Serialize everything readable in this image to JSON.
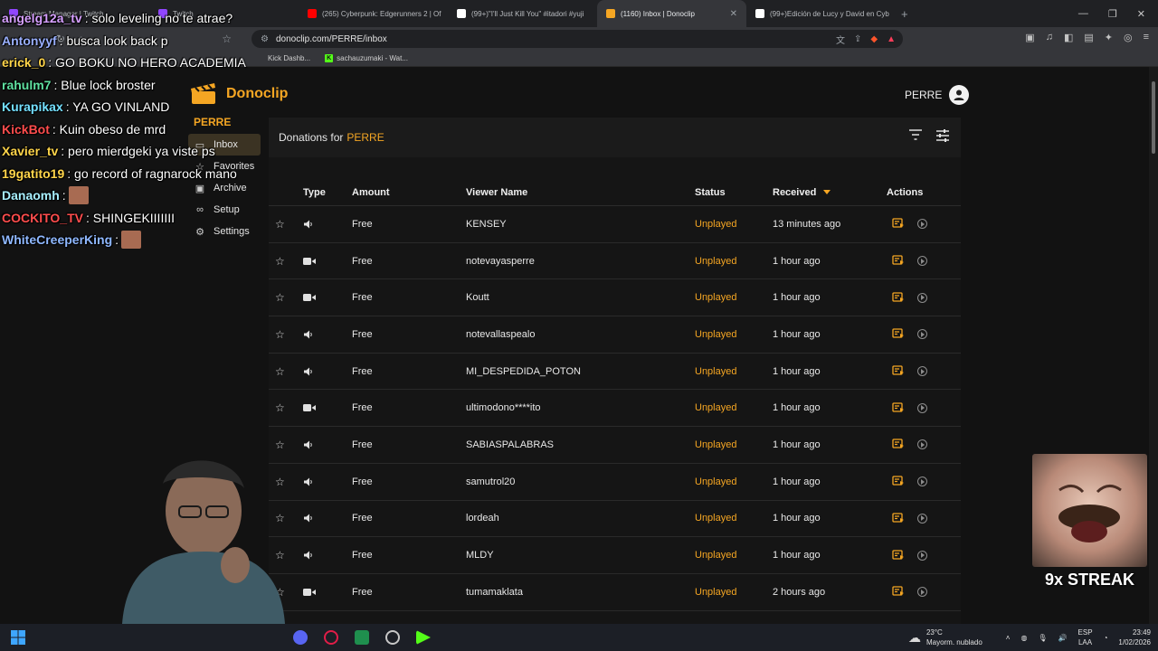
{
  "browser": {
    "tabs": [
      {
        "label": "Stream Manager | Twitch",
        "color": "#9146ff",
        "active": false
      },
      {
        "label": "Twitch",
        "color": "#9146ff",
        "active": false
      },
      {
        "label": "(265) Cyberpunk: Edgerunners 2 | Of",
        "color": "#ff0000",
        "active": false
      },
      {
        "label": "(99+)\"I'll Just Kill You\" #itadori #yuji",
        "color": "#ffffff",
        "active": false
      },
      {
        "label": "(1160) Inbox | Donoclip",
        "color": "#f5a623",
        "active": true
      },
      {
        "label": "(99+)Edición de Lucy y David en Cyb",
        "color": "#ffffff",
        "active": false
      }
    ],
    "url": "donoclip.com/PERRE/inbox",
    "bookmarks": [
      "Kick Dashb...",
      "sachauzumaki - Wat..."
    ]
  },
  "app": {
    "brand": "Donoclip",
    "user": "PERRE",
    "channel": "PERRE",
    "nav": [
      {
        "label": "Inbox",
        "icon": "inbox-icon",
        "active": true
      },
      {
        "label": "Favorites",
        "icon": "star-icon",
        "active": false
      },
      {
        "label": "Archive",
        "icon": "archive-icon",
        "active": false
      },
      {
        "label": "Setup",
        "icon": "link-icon",
        "active": false
      },
      {
        "label": "Settings",
        "icon": "gear-icon",
        "active": false
      }
    ],
    "panel_title": "Donations for",
    "columns": {
      "type": "Type",
      "amount": "Amount",
      "viewer": "Viewer Name",
      "status": "Status",
      "received": "Received",
      "actions": "Actions"
    },
    "rows": [
      {
        "type": "audio",
        "amount": "Free",
        "viewer": "KENSEY",
        "status": "Unplayed",
        "received": "13 minutes ago"
      },
      {
        "type": "video",
        "amount": "Free",
        "viewer": "notevayasperre",
        "status": "Unplayed",
        "received": "1 hour ago"
      },
      {
        "type": "video",
        "amount": "Free",
        "viewer": "Koutt",
        "status": "Unplayed",
        "received": "1 hour ago"
      },
      {
        "type": "audio",
        "amount": "Free",
        "viewer": "notevallaspealo",
        "status": "Unplayed",
        "received": "1 hour ago"
      },
      {
        "type": "audio",
        "amount": "Free",
        "viewer": "MI_DESPEDIDA_POTON",
        "status": "Unplayed",
        "received": "1 hour ago"
      },
      {
        "type": "video",
        "amount": "Free",
        "viewer": "ultimodono****ito",
        "status": "Unplayed",
        "received": "1 hour ago"
      },
      {
        "type": "audio",
        "amount": "Free",
        "viewer": "SABIASPALABRAS",
        "status": "Unplayed",
        "received": "1 hour ago"
      },
      {
        "type": "audio",
        "amount": "Free",
        "viewer": "samutrol20",
        "status": "Unplayed",
        "received": "1 hour ago"
      },
      {
        "type": "audio",
        "amount": "Free",
        "viewer": "lordeah",
        "status": "Unplayed",
        "received": "1 hour ago"
      },
      {
        "type": "audio",
        "amount": "Free",
        "viewer": "MLDY",
        "status": "Unplayed",
        "received": "1 hour ago"
      },
      {
        "type": "video",
        "amount": "Free",
        "viewer": "tumamaklata",
        "status": "Unplayed",
        "received": "2 hours ago"
      }
    ]
  },
  "chat": [
    {
      "user": "angelg12a_tv",
      "color": "#d6a0ff",
      "msg": ": solo leveling no te atrae?"
    },
    {
      "user": "Antonyyf",
      "color": "#9ab0ff",
      "msg": ": busca look back p"
    },
    {
      "user": "erick_0",
      "color": "#ffd54a",
      "msg": ": GO BOKU NO HERO ACADEMIA"
    },
    {
      "user": "rahulm7",
      "color": "#5fe0a0",
      "msg": ": Blue lock broster"
    },
    {
      "user": "Kurapikax",
      "color": "#74e0ff",
      "msg": ": YA GO VINLAND"
    },
    {
      "user": "KickBot",
      "color": "#ff4d4d",
      "msg": ": Kuin obeso de mrd"
    },
    {
      "user": "Xavier_tv",
      "color": "#ffd54a",
      "msg": ": pero mierdgeki ya viste ps"
    },
    {
      "user": "19gatito19",
      "color": "#ffd54a",
      "msg": ": go record of ragnarock mano"
    },
    {
      "user": "Danaomh",
      "color": "#a8f0ff",
      "msg": ":"
    },
    {
      "user": "COCKITO_TV",
      "color": "#ff4d4d",
      "msg": ": SHINGEKIIIIIII"
    },
    {
      "user": "WhiteCreeperKing",
      "color": "#8fb8ff",
      "msg": ":"
    }
  ],
  "overlay": {
    "streak": "9x STREAK"
  },
  "taskbar": {
    "weather_temp": "23°C",
    "weather_desc": "Mayorm. nublado",
    "lang_top": "ESP",
    "lang_bottom": "LAA",
    "time": "23:49",
    "date": "1/02/2026"
  }
}
